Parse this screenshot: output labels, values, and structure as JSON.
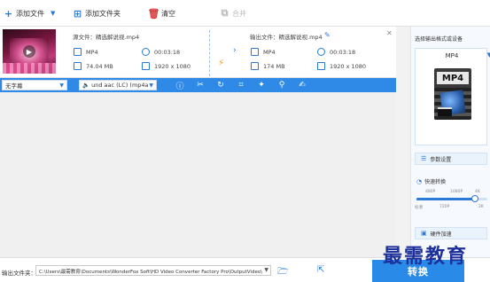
{
  "toolbar": {
    "add_file": "添加文件",
    "add_folder": "添加文件夹",
    "clear": "清空",
    "merge": "合并"
  },
  "file": {
    "source_name": "源文件：精选解说视.mp4",
    "source": {
      "format": "MP4",
      "duration": "00:03:18",
      "size": "74.04 MB",
      "resolution": "1920 x 1080"
    },
    "output_name": "输出文件：精选解说视.mp4",
    "output": {
      "format": "MP4",
      "duration": "00:03:18",
      "size": "174 MB",
      "resolution": "1920 x 1080"
    }
  },
  "actionbar": {
    "subtitle_select": "无字幕",
    "audio_select": "und aac (LC) (mp4a"
  },
  "right_panel": {
    "title": "选择输出格式或设备",
    "format": "MP4",
    "format_icon_text": "MP4",
    "param_settings": "参数设置",
    "speed_label": "快速转换",
    "speed_top_ticks": [
      "480P",
      "1080P",
      "4K"
    ],
    "speed_bottom_ticks": [
      "标清",
      "720P",
      "2K"
    ],
    "speed_level": 0.82,
    "hw_accel": "硬件加速"
  },
  "bottom": {
    "output_dir_label": "输出文件夹：",
    "output_path": "C:\\Users\\最需教育\\Documents\\WonderFox Soft\\HD Video Converter Factory Pro\\OutputVideo\\",
    "convert_label": "转换"
  },
  "watermark": "最需教育",
  "colors": {
    "accent": "#2e8ae6",
    "bolt": "#f29a1c",
    "clear": "#d83a3a"
  }
}
